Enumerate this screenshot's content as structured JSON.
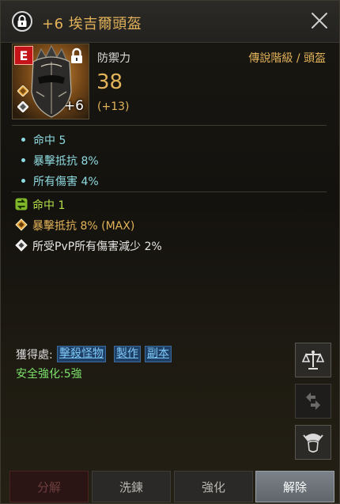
{
  "header": {
    "title": "+6 埃吉爾頭盔"
  },
  "item": {
    "grade_letter": "E",
    "enhance_level": "+6",
    "stat_name": "防禦力",
    "stat_value": "38",
    "stat_bonus": "(+13)",
    "grade_category": "傳說階級 / 頭盔"
  },
  "base_options": [
    {
      "label": "命中 5"
    },
    {
      "label": "暴擊抵抗 8%"
    },
    {
      "label": "所有傷害 4%"
    }
  ],
  "extra_options": [
    {
      "icon": "green-swap-icon",
      "label": "命中 1",
      "color": "#b4e04a"
    },
    {
      "icon": "gold-diamond-icon",
      "label": "暴擊抵抗 8% (MAX)",
      "color": "#e3b35a"
    },
    {
      "icon": "white-diamond-icon",
      "label": "所受PvP所有傷害減少 2%",
      "color": "#e6e6e6"
    }
  ],
  "source": {
    "label": "獲得處:",
    "links": [
      "擊殺怪物",
      "製作",
      "副本"
    ]
  },
  "safe_enhance": "安全強化:5強",
  "side_buttons": [
    {
      "icon": "scales-icon",
      "enabled": true
    },
    {
      "icon": "swap-arrows-icon",
      "enabled": false
    },
    {
      "icon": "armor-helmet-icon",
      "enabled": true
    }
  ],
  "bottom_buttons": [
    {
      "label": "分解",
      "state": "disabled"
    },
    {
      "label": "洗鍊",
      "state": "normal"
    },
    {
      "label": "強化",
      "state": "normal"
    },
    {
      "label": "解除",
      "state": "active"
    }
  ],
  "colors": {
    "gold": "#e3b35a",
    "cyan": "#8edbe1",
    "green": "#7ce06a",
    "red_badge": "#c4141a",
    "link_blue": "#7ec8f7"
  }
}
